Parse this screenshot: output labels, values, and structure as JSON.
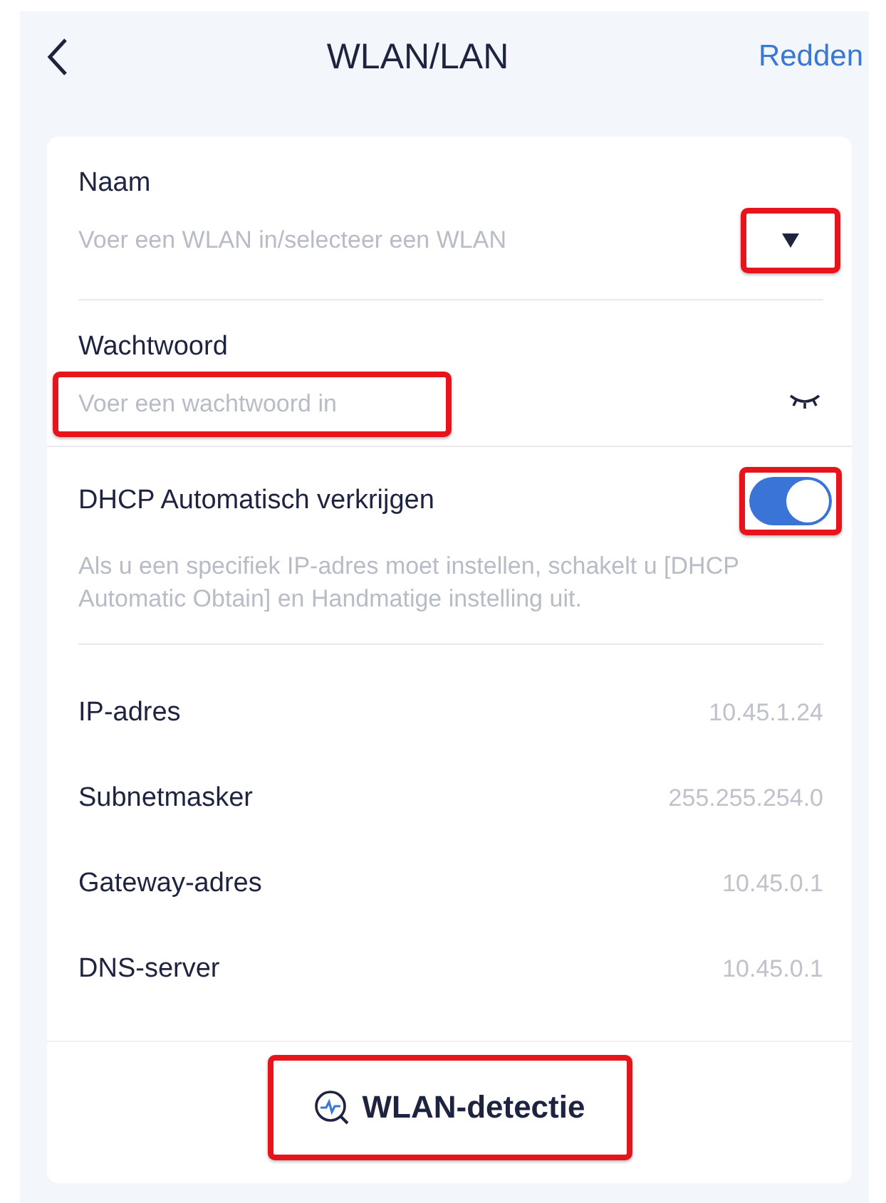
{
  "header": {
    "title": "WLAN/LAN",
    "action": "Redden"
  },
  "fields": [
    {
      "kind": "select",
      "label": "Naam",
      "placeholder": "Voer een WLAN in/selecteer een WLAN",
      "highlighted": true
    },
    {
      "kind": "password",
      "label": "Wachtwoord",
      "placeholder": "Voer een wachtwoord in",
      "highlighted": true
    }
  ],
  "dhcp": {
    "label": "DHCP Automatisch verkrijgen",
    "on": true,
    "highlighted": true,
    "hint": "Als u een specifiek IP-adres moet instellen, schakelt u [DHCP Automatic Obtain] en Handmatige instelling uit."
  },
  "network": [
    {
      "label": "IP-adres",
      "value": "10.45.1.24"
    },
    {
      "label": "Subnetmasker",
      "value": "255.255.254.0"
    },
    {
      "label": "Gateway-adres",
      "value": "10.45.0.1"
    },
    {
      "label": "DNS-server",
      "value": "10.45.0.1"
    }
  ],
  "detect_button": {
    "label": "WLAN-detectie",
    "highlighted": true
  }
}
